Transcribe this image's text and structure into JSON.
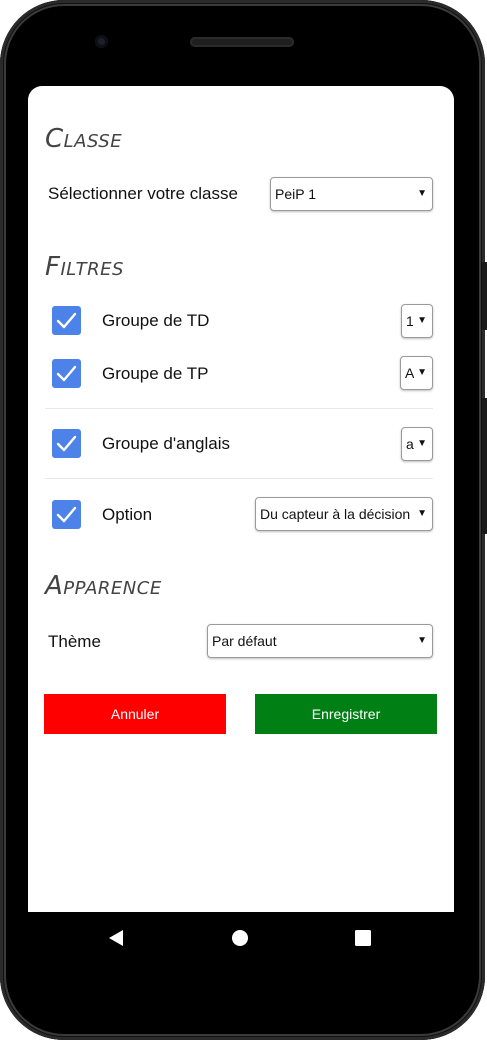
{
  "sections": {
    "classe": "Classe",
    "filtres": "Filtres",
    "apparence": "Apparence"
  },
  "classe": {
    "label": "Sélectionner votre classe",
    "selected": "PeiP 1"
  },
  "filters": [
    {
      "label": "Groupe de TD",
      "checked": true,
      "selected": "1"
    },
    {
      "label": "Groupe de TP",
      "checked": true,
      "selected": "A"
    },
    {
      "label": "Groupe d'anglais",
      "checked": true,
      "selected": "a"
    },
    {
      "label": "Option",
      "checked": true,
      "selected": "Du capteur à la décision"
    }
  ],
  "apparence": {
    "label": "Thème",
    "selected": "Par défaut"
  },
  "buttons": {
    "cancel": "Annuler",
    "save": "Enregistrer"
  },
  "colors": {
    "cancel": "#ff0000",
    "save": "#007f14",
    "checkbox": "#4d82e8"
  },
  "icons": {
    "dropdown": "▼",
    "nav_back": "back-triangle-icon",
    "nav_home": "home-circle-icon",
    "nav_recents": "recents-square-icon"
  }
}
